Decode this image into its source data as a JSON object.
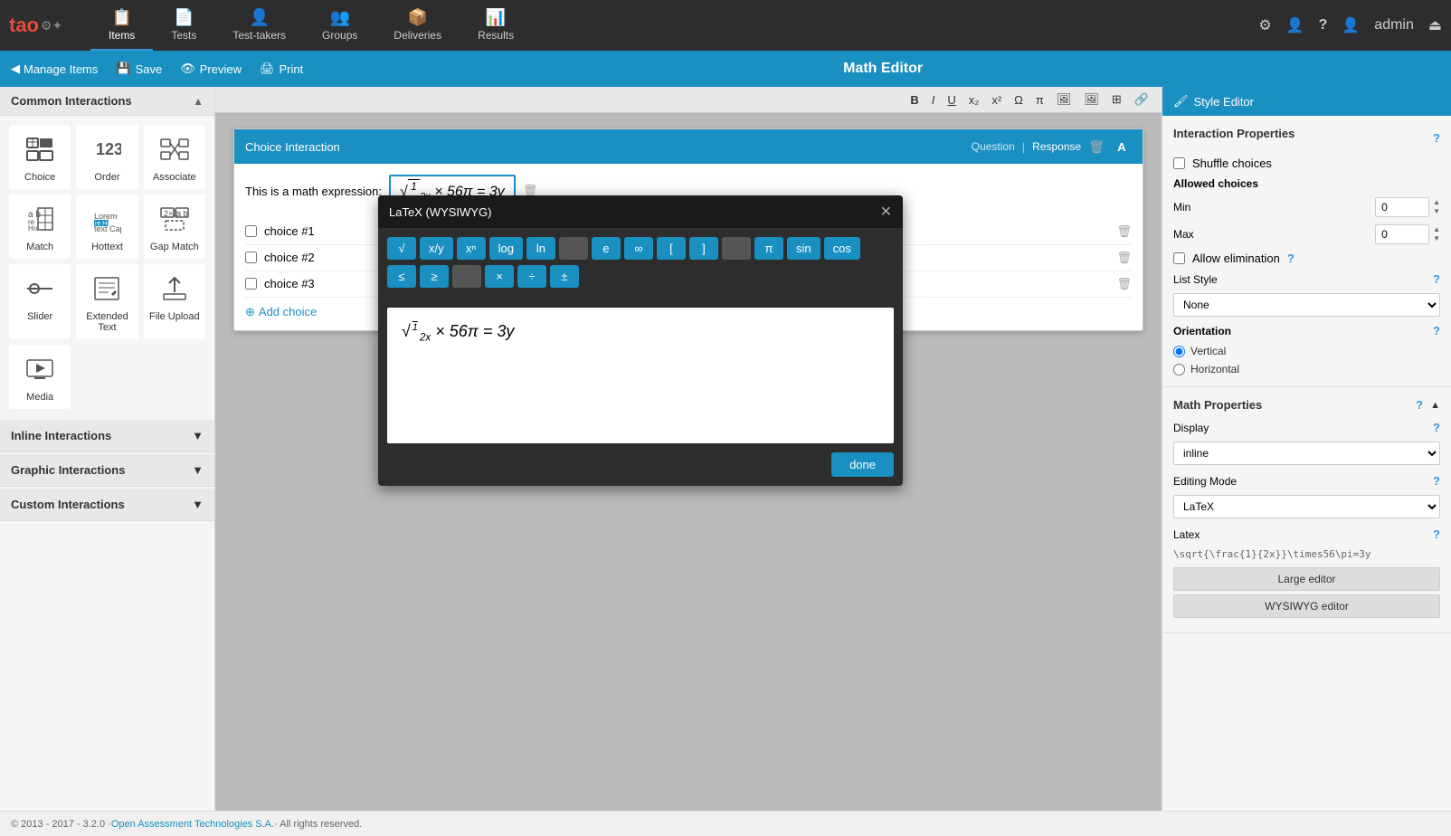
{
  "app": {
    "logo": "tao",
    "title": "Math Editor"
  },
  "top_nav": {
    "items": [
      {
        "label": "Items",
        "icon": "📋",
        "active": true
      },
      {
        "label": "Tests",
        "icon": "📄"
      },
      {
        "label": "Test-takers",
        "icon": "👤"
      },
      {
        "label": "Groups",
        "icon": "👥"
      },
      {
        "label": "Deliveries",
        "icon": "📦"
      },
      {
        "label": "Results",
        "icon": "📊"
      }
    ],
    "right": {
      "settings_icon": "⚙",
      "users_icon": "👤",
      "help_icon": "?",
      "admin_label": "admin",
      "logout_icon": "⏏"
    }
  },
  "sub_header": {
    "back_label": "Manage Items",
    "save_label": "Save",
    "preview_label": "Preview",
    "print_label": "Print",
    "title": "Math Editor"
  },
  "style_editor": {
    "title": "Style Editor"
  },
  "left_sidebar": {
    "common_section": "Common Interactions",
    "interactions": [
      {
        "label": "Choice",
        "icon": "choice"
      },
      {
        "label": "Order",
        "icon": "order"
      },
      {
        "label": "Associate",
        "icon": "associate"
      },
      {
        "label": "Match",
        "icon": "match"
      },
      {
        "label": "Hottext",
        "icon": "hottext"
      },
      {
        "label": "Gap Match",
        "icon": "gapmatch"
      },
      {
        "label": "Slider",
        "icon": "slider"
      },
      {
        "label": "Extended Text",
        "icon": "exttext"
      },
      {
        "label": "File Upload",
        "icon": "fileupload"
      },
      {
        "label": "Media",
        "icon": "media"
      }
    ],
    "inline_section": "Inline Interactions",
    "graphic_section": "Graphic Interactions",
    "custom_section": "Custom Interactions"
  },
  "choice_panel": {
    "title": "Choice Interaction",
    "tab_question": "Question",
    "tab_response": "Response",
    "expression_label": "This is a math expression:",
    "math_expression": "√(1/2x) × 56π = 3y",
    "choices": [
      {
        "label": "choice #1"
      },
      {
        "label": "choice #2"
      },
      {
        "label": "choice #3"
      }
    ],
    "add_choice_label": "Add choice"
  },
  "toolbar": {
    "buttons": [
      "B",
      "I",
      "U",
      "x₂",
      "x²",
      "Ω",
      "π",
      "🖼",
      "🖼",
      "⊞",
      "🔗"
    ]
  },
  "latex_modal": {
    "title": "LaTeX (WYSIWYG)",
    "buttons_row1": [
      "√",
      "x/y",
      "xⁿ",
      "log",
      "ln",
      "e",
      "∞",
      "[",
      "]",
      "π",
      "sin",
      "cos"
    ],
    "buttons_row2": [
      "≤",
      "≥",
      "×",
      "÷",
      "±"
    ],
    "preview_math": "√(1/2x) × 56π = 3y",
    "done_label": "done"
  },
  "right_sidebar": {
    "title": "Style Editor",
    "style_icon": "🖌",
    "sections": {
      "interaction_properties": {
        "title": "Interaction Properties",
        "shuffle_choices_label": "Shuffle choices",
        "allowed_choices": "Allowed choices",
        "min_label": "Min",
        "min_value": "0",
        "max_label": "Max",
        "max_value": "0",
        "allow_elimination_label": "Allow elimination",
        "list_style_label": "List Style",
        "list_style_value": "None",
        "orientation_label": "Orientation",
        "vertical_label": "Vertical",
        "horizontal_label": "Horizontal"
      },
      "math_properties": {
        "title": "Math Properties",
        "display_label": "Display",
        "display_value": "inline",
        "editing_mode_label": "Editing Mode",
        "editing_mode_value": "LaTeX",
        "latex_label": "Latex",
        "latex_value": "\\sqrt{\\frac{1}{2x}}\\times56\\pi=3y",
        "large_editor_label": "Large editor",
        "wysiwyg_label": "WYSIWYG editor"
      }
    }
  },
  "footer": {
    "copyright": "© 2013 - 2017 - 3.2.0 · ",
    "company": "Open Assessment Technologies S.A.",
    "rights": " · All rights reserved."
  }
}
